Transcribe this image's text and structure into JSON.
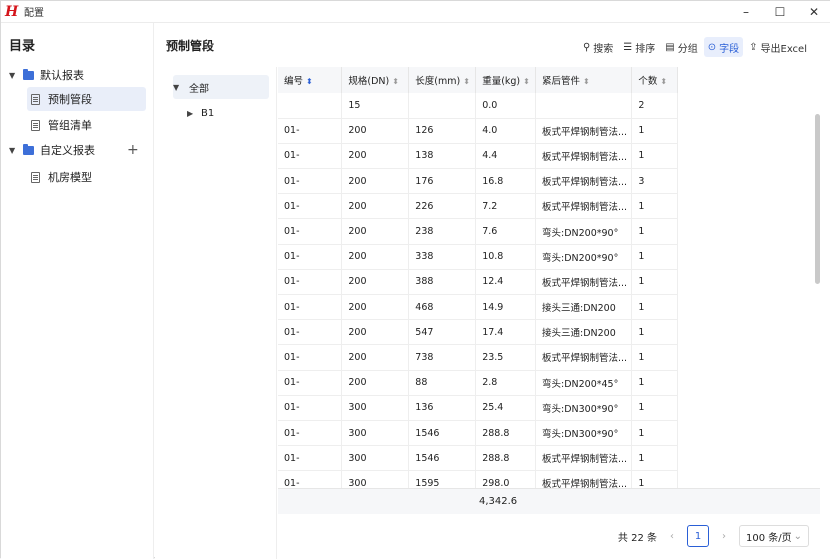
{
  "window": {
    "title": "配置",
    "controls": [
      "–",
      "☐",
      "✕"
    ]
  },
  "sidebar": {
    "title": "目录",
    "items": [
      {
        "label": "默认报表",
        "kind": "folder"
      },
      {
        "label": "预制管段",
        "kind": "doc"
      },
      {
        "label": "管组清单",
        "kind": "doc"
      },
      {
        "label": "自定义报表",
        "kind": "folder"
      },
      {
        "label": "机房模型",
        "kind": "doc"
      }
    ],
    "add_icon": "+"
  },
  "main": {
    "title": "预制管段",
    "toolbar": {
      "search": "搜索",
      "sort": "排序",
      "group": "分组",
      "fields": "字段",
      "export": "导出Excel"
    },
    "groups": {
      "root": "全部",
      "child": "B1"
    },
    "table": {
      "headers": [
        "编号",
        "规格(DN)",
        "长度(mm)",
        "重量(kg)",
        "紧后管件",
        "个数"
      ],
      "rows": [
        [
          "",
          "15",
          "",
          "0.0",
          "",
          "2"
        ],
        [
          "01-",
          "200",
          "126",
          "4.0",
          "板式平焊钢制管法...",
          "1"
        ],
        [
          "01-",
          "200",
          "138",
          "4.4",
          "板式平焊钢制管法...",
          "1"
        ],
        [
          "01-",
          "200",
          "176",
          "16.8",
          "板式平焊钢制管法...",
          "3"
        ],
        [
          "01-",
          "200",
          "226",
          "7.2",
          "板式平焊钢制管法...",
          "1"
        ],
        [
          "01-",
          "200",
          "238",
          "7.6",
          "弯头:DN200*90°",
          "1"
        ],
        [
          "01-",
          "200",
          "338",
          "10.8",
          "弯头:DN200*90°",
          "1"
        ],
        [
          "01-",
          "200",
          "388",
          "12.4",
          "板式平焊钢制管法...",
          "1"
        ],
        [
          "01-",
          "200",
          "468",
          "14.9",
          "接头三通:DN200",
          "1"
        ],
        [
          "01-",
          "200",
          "547",
          "17.4",
          "接头三通:DN200",
          "1"
        ],
        [
          "01-",
          "200",
          "738",
          "23.5",
          "板式平焊钢制管法...",
          "1"
        ],
        [
          "01-",
          "200",
          "88",
          "2.8",
          "弯头:DN200*45°",
          "1"
        ],
        [
          "01-",
          "300",
          "136",
          "25.4",
          "弯头:DN300*90°",
          "1"
        ],
        [
          "01-",
          "300",
          "1546",
          "288.8",
          "弯头:DN300*90°",
          "1"
        ],
        [
          "01-",
          "300",
          "1546",
          "288.8",
          "板式平焊钢制管法...",
          "1"
        ],
        [
          "01-",
          "300",
          "1595",
          "298.0",
          "板式平焊钢制管法...",
          "1"
        ]
      ],
      "weight_total": "4,342.6"
    },
    "pager": {
      "total": "共 22 条",
      "page": "1",
      "page_size": "100 条/页"
    }
  }
}
